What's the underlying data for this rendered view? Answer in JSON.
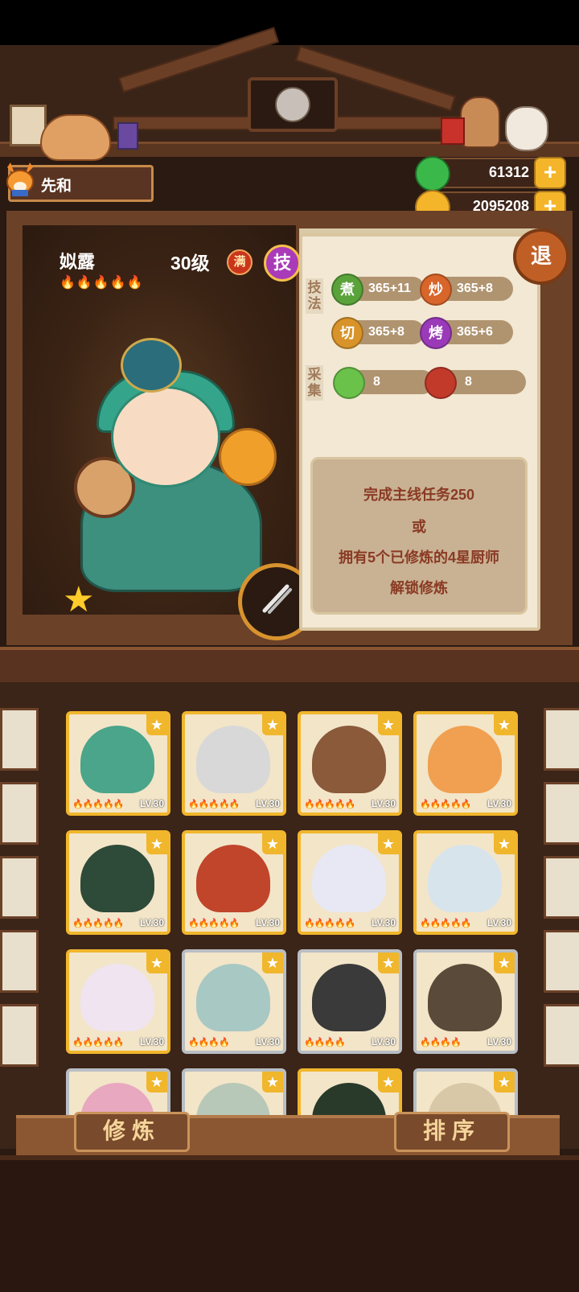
{
  "player": {
    "name": "先和",
    "icon": "fox-avatar-icon"
  },
  "currencies": [
    {
      "name": "jade",
      "icon": "green-gem-icon",
      "value": "61312",
      "color": "#3bb84a"
    },
    {
      "name": "coin",
      "icon": "gold-coin-icon",
      "value": "2095208",
      "color": "#f4b52a"
    }
  ],
  "retreat_label": "退",
  "chef": {
    "name": "姒露",
    "flames": "🔥🔥🔥🔥🔥",
    "level": "30级",
    "full_badge": "满",
    "skill_button": "技",
    "stars": "★"
  },
  "skills_section_label": "技法",
  "skills": [
    {
      "label": "煮",
      "value": "365+11",
      "color": "#5aa23a"
    },
    {
      "label": "炒",
      "value": "365+8",
      "color": "#d8652a"
    },
    {
      "label": "切",
      "value": "365+8",
      "color": "#d8942a"
    },
    {
      "label": "烤",
      "value": "365+6",
      "color": "#9a3ab8"
    }
  ],
  "gather_section_label": "采集",
  "gather": [
    {
      "icon": "cabbage-icon",
      "value": "8",
      "color": "#6bc24a"
    },
    {
      "icon": "meat-icon",
      "value": "8",
      "color": "#c23a2a"
    }
  ],
  "unlock_text": [
    "完成主线任务250",
    "或",
    "拥有5个已修炼的4星厨师",
    "解锁修炼"
  ],
  "knife_icon": "knife-icon",
  "roster": [
    {
      "level": "LV.30",
      "flames": "🔥🔥🔥🔥🔥",
      "color": "#4aa58a",
      "border": "gold"
    },
    {
      "level": "LV.30",
      "flames": "🔥🔥🔥🔥🔥",
      "color": "#d8d8d8",
      "border": "gold"
    },
    {
      "level": "LV.30",
      "flames": "🔥🔥🔥🔥🔥",
      "color": "#8a5a3a",
      "border": "gold"
    },
    {
      "level": "LV.30",
      "flames": "🔥🔥🔥🔥🔥",
      "color": "#f0a050",
      "border": "gold"
    },
    {
      "level": "LV.30",
      "flames": "🔥🔥🔥🔥🔥",
      "color": "#2e4a38",
      "border": "gold"
    },
    {
      "level": "LV.30",
      "flames": "🔥🔥🔥🔥🔥",
      "color": "#c0452a",
      "border": "gold"
    },
    {
      "level": "LV.30",
      "flames": "🔥🔥🔥🔥🔥",
      "color": "#e8e8f4",
      "border": "gold"
    },
    {
      "level": "LV.30",
      "flames": "🔥🔥🔥🔥🔥",
      "color": "#d8e4ec",
      "border": "gold"
    },
    {
      "level": "LV.30",
      "flames": "🔥🔥🔥🔥🔥",
      "color": "#f0e4f0",
      "border": "gold"
    },
    {
      "level": "LV.30",
      "flames": "🔥🔥🔥🔥",
      "color": "#a8c8c4",
      "border": "silver"
    },
    {
      "level": "LV.30",
      "flames": "🔥🔥🔥🔥",
      "color": "#3a3a3a",
      "border": "silver"
    },
    {
      "level": "LV.30",
      "flames": "🔥🔥🔥🔥",
      "color": "#5a4a3a",
      "border": "silver"
    },
    {
      "level": "",
      "flames": "",
      "color": "#e8a8c0",
      "border": "silver"
    },
    {
      "level": "",
      "flames": "",
      "color": "#b8c8b8",
      "border": "silver"
    },
    {
      "level": "",
      "flames": "",
      "color": "#2a3a2a",
      "border": "gold"
    },
    {
      "level": "",
      "flames": "",
      "color": "#d8c8a8",
      "border": "silver"
    }
  ],
  "star_glyph": "★",
  "buttons": {
    "cultivate": "修炼",
    "sort": "排序"
  }
}
